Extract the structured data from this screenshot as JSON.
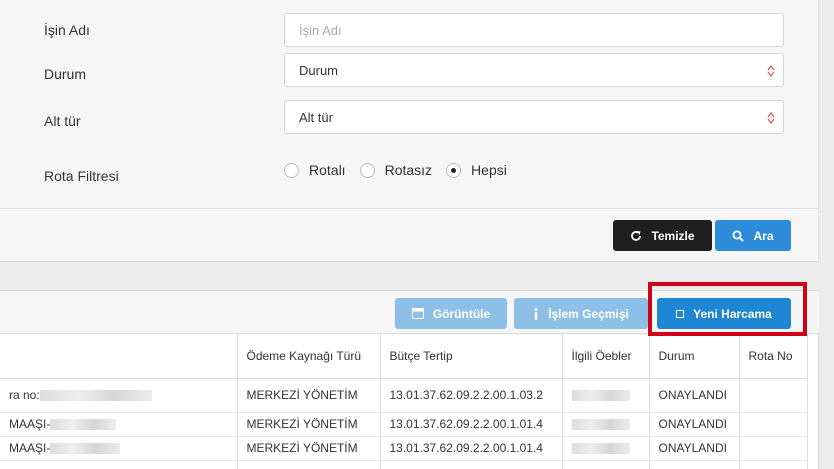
{
  "filters": {
    "job_name_label": "İşin Adı",
    "job_name_placeholder": "İşin Adı",
    "status_label": "Durum",
    "status_value": "Durum",
    "subtype_label": "Alt tür",
    "subtype_value": "Alt tür",
    "route_filter_label": "Rota Filtresi",
    "route_options": [
      "Rotalı",
      "Rotasız",
      "Hepsi"
    ],
    "route_selected": "Hepsi"
  },
  "actions": {
    "clear_label": "Temizle",
    "search_label": "Ara"
  },
  "toolbar": {
    "view_label": "Görüntüle",
    "history_label": "İşlem Geçmişi",
    "new_expense_label": "Yeni Harcama"
  },
  "table": {
    "headers": [
      "Ödeme Kaynağı Türü",
      "Bütçe Tertip",
      "İlgili Öebler",
      "Durum",
      "Rota No"
    ],
    "rows": [
      {
        "name_prefix": "ra no:",
        "kaynak": "MERKEZİ YÖNETİM",
        "butce": "13.01.37.62.09.2.2.00.1.03.2",
        "durum": "ONAYLANDI",
        "rota": ""
      },
      {
        "name_prefix": "MAAŞI-",
        "kaynak": "MERKEZİ YÖNETİM",
        "butce": "13.01.37.62.09.2.2.00.1.01.4",
        "durum": "ONAYLANDI",
        "rota": ""
      },
      {
        "name_prefix": " MAAŞI-",
        "kaynak": "MERKEZİ YÖNETİM",
        "butce": "13.01.37.62.09.2.2.00.1.01.4",
        "durum": "ONAYLANDI",
        "rota": ""
      }
    ]
  },
  "colors": {
    "primary": "#2e8bd9",
    "primary_disabled": "#8ebfe6",
    "dark_button": "#1f1f1f",
    "highlight": "#d0021b"
  }
}
